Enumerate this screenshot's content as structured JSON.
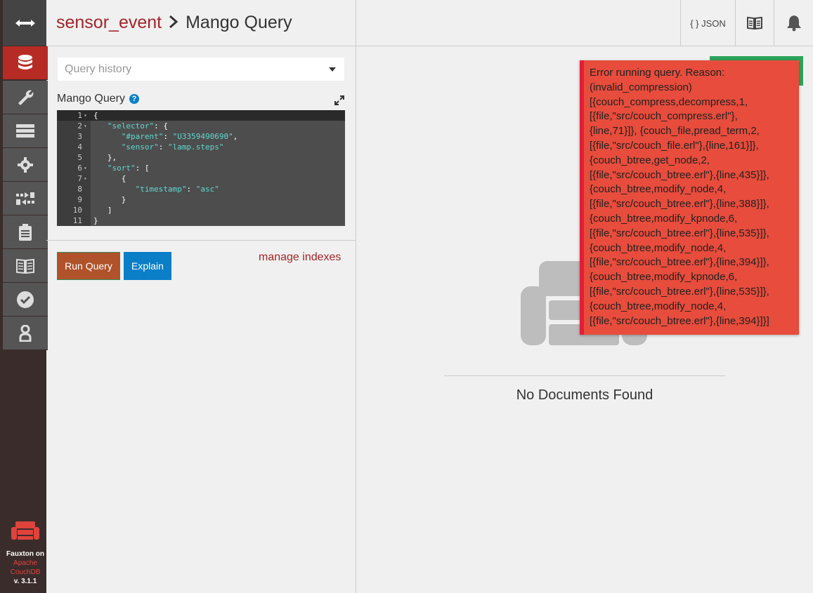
{
  "header": {
    "db_name": "sensor_event",
    "separator": ">",
    "page_title": "Mango Query",
    "json_label": "{ } JSON"
  },
  "query": {
    "history_placeholder": "Query history",
    "label": "Mango Query",
    "help": "?",
    "code_lines": [
      {
        "n": "1",
        "fold": "▾",
        "text": "{"
      },
      {
        "n": "2",
        "fold": "▾",
        "text": "   \"selector\": {"
      },
      {
        "n": "3",
        "fold": "",
        "text": "      \"#parent\": \"U3359490690\","
      },
      {
        "n": "4",
        "fold": "",
        "text": "      \"sensor\": \"lamp.steps\""
      },
      {
        "n": "5",
        "fold": "",
        "text": "   },"
      },
      {
        "n": "6",
        "fold": "▾",
        "text": "   \"sort\": ["
      },
      {
        "n": "7",
        "fold": "▾",
        "text": "      {"
      },
      {
        "n": "8",
        "fold": "",
        "text": "         \"timestamp\": \"asc\""
      },
      {
        "n": "9",
        "fold": "",
        "text": "      }"
      },
      {
        "n": "10",
        "fold": "",
        "text": "   ]"
      },
      {
        "n": "11",
        "fold": "",
        "text": "}"
      }
    ],
    "run_label": "Run Query",
    "explain_label": "Explain",
    "manage_indexes": "manage indexes"
  },
  "results": {
    "empty_text": "No Documents Found"
  },
  "error": {
    "lines": [
      "Error running query. Reason:",
      "(invalid_compression)",
      "[{couch_compress,decompress,1,",
      "[{file,\"src/couch_compress.erl\"},",
      "{line,71}]}, {couch_file,pread_term,2,",
      "[{file,\"src/couch_file.erl\"},{line,161}]},",
      "{couch_btree,get_node,2,",
      "[{file,\"src/couch_btree.erl\"},{line,435}]},",
      "{couch_btree,modify_node,4,",
      "[{file,\"src/couch_btree.erl\"},{line,388}]},",
      "{couch_btree,modify_kpnode,6,",
      "[{file,\"src/couch_btree.erl\"},{line,535}]},",
      "{couch_btree,modify_node,4,",
      "[{file,\"src/couch_btree.erl\"},{line,394}]},",
      "{couch_btree,modify_kpnode,6,",
      "[{file,\"src/couch_btree.erl\"},{line,535}]},",
      "{couch_btree,modify_node,4,",
      "[{file,\"src/couch_btree.erl\"},{line,394}]}]"
    ]
  },
  "sidebar": {
    "icons": [
      "toggle-arrows-icon",
      "database-icon",
      "wrench-icon",
      "server-icon",
      "gear-icon",
      "replication-icon",
      "clipboard-icon",
      "book-icon",
      "check-circle-icon",
      "user-icon"
    ],
    "footer_line1": "Fauxton on",
    "footer_line2": "Apache",
    "footer_line3": "CouchDB",
    "footer_version": "v. 3.1.1"
  },
  "colors": {
    "accent_red": "#b72b25",
    "error_bg": "#e74c3c",
    "run_button": "#b0522a",
    "explain_button": "#0a7ec7",
    "success_green": "#2ca45a"
  }
}
